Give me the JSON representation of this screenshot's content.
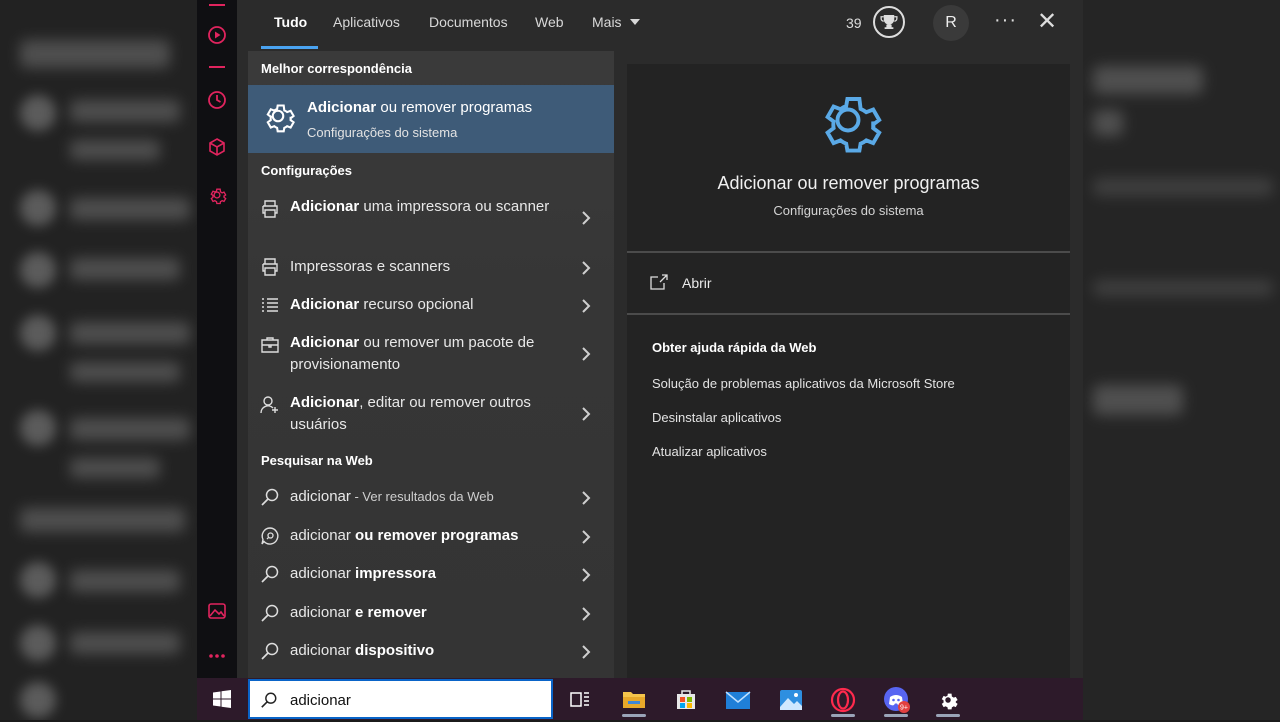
{
  "tabs": [
    {
      "label": "Tudo",
      "active": true
    },
    {
      "label": "Aplicativos"
    },
    {
      "label": "Documentos"
    },
    {
      "label": "Web"
    },
    {
      "label": "Mais"
    }
  ],
  "header": {
    "points": "39",
    "avatar_initial": "R"
  },
  "best_match": {
    "section_title": "Melhor correspondência",
    "title_bold": "Adicionar",
    "title_rest": " ou remover programas",
    "subtitle": "Configurações do sistema"
  },
  "settings_section": {
    "title": "Configurações",
    "items": [
      {
        "bold": "Adicionar",
        "rest": " uma impressora ou scanner",
        "icon": "printer-icon"
      },
      {
        "bold": "",
        "rest": "Impressoras e scanners",
        "icon": "printer-icon"
      },
      {
        "bold": "Adicionar",
        "rest": " recurso opcional",
        "icon": "list-icon"
      },
      {
        "bold": "Adicionar",
        "rest": " ou remover um pacote de provisionamento",
        "icon": "package-icon"
      },
      {
        "bold": "Adicionar",
        "rest": ", editar ou remover outros usuários",
        "icon": "user-add-icon"
      }
    ]
  },
  "web_section": {
    "title": "Pesquisar na Web",
    "items": [
      {
        "term": "adicionar",
        "bold": "",
        "suffix": " - Ver resultados da Web",
        "icon": "search-icon"
      },
      {
        "term": "adicionar ",
        "bold": "ou remover programas",
        "suffix": "",
        "icon": "chat-search-icon"
      },
      {
        "term": "adicionar ",
        "bold": "impressora",
        "suffix": "",
        "icon": "search-icon"
      },
      {
        "term": "adicionar ",
        "bold": "e remover",
        "suffix": "",
        "icon": "search-icon"
      },
      {
        "term": "adicionar ",
        "bold": "dispositivo",
        "suffix": "",
        "icon": "search-icon"
      }
    ]
  },
  "preview": {
    "title": "Adicionar ou remover programas",
    "subtitle": "Configurações do sistema",
    "open_label": "Abrir",
    "help_title": "Obter ajuda rápida da Web",
    "help_links": [
      "Solução de problemas aplicativos da Microsoft Store",
      "Desinstalar aplicativos",
      "Atualizar aplicativos"
    ]
  },
  "taskbar": {
    "search_value": "adicionar",
    "apps": [
      "task-view-icon",
      "file-explorer-icon",
      "microsoft-store-icon",
      "mail-icon",
      "photos-icon",
      "opera-gx-icon",
      "discord-icon",
      "settings-icon"
    ],
    "discord_badge": "9+"
  },
  "colors": {
    "accent": "#4aa3f0",
    "selected": "#3e5b78",
    "opera_accent": "#e0245e"
  }
}
